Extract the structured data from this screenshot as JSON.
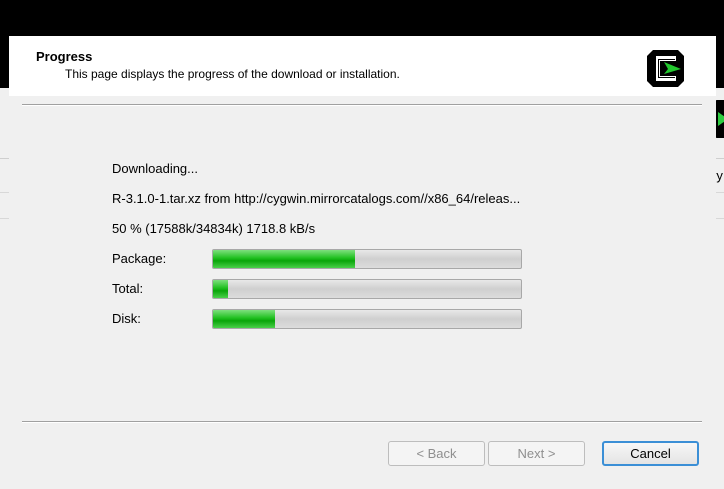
{
  "header": {
    "title": "Progress",
    "subtitle": "This page displays the progress of the download or installation."
  },
  "logo_icon": "cygwin-logo-icon",
  "status": "Downloading...",
  "file": "R-3.1.0-1.tar.xz from http://cygwin.mirrorcatalogs.com//x86_64/releas...",
  "stats": "50 %  (17588k/34834k)  1718.8 kB/s",
  "progress": [
    {
      "label": "Package:",
      "percent": 46
    },
    {
      "label": "Total:",
      "percent": 5
    },
    {
      "label": "Disk:",
      "percent": 20
    }
  ],
  "buttons": {
    "back": "< Back",
    "next": "Next >",
    "cancel": "Cancel"
  },
  "background_window": {
    "partial_text": "ry"
  },
  "colors": {
    "progress_fill": "#1fbf1f",
    "accent_border": "#3b8fd6"
  }
}
